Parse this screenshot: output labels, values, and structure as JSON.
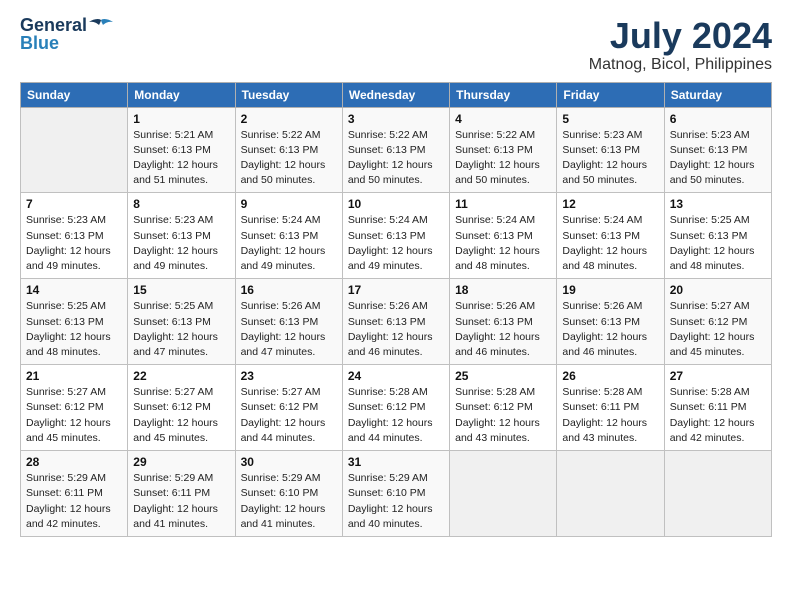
{
  "header": {
    "logo_general": "General",
    "logo_blue": "Blue",
    "month": "July 2024",
    "location": "Matnog, Bicol, Philippines"
  },
  "columns": [
    "Sunday",
    "Monday",
    "Tuesday",
    "Wednesday",
    "Thursday",
    "Friday",
    "Saturday"
  ],
  "weeks": [
    [
      null,
      {
        "day": "1",
        "sunrise": "5:21 AM",
        "sunset": "6:13 PM",
        "daylight": "12 hours and 51 minutes."
      },
      {
        "day": "2",
        "sunrise": "5:22 AM",
        "sunset": "6:13 PM",
        "daylight": "12 hours and 50 minutes."
      },
      {
        "day": "3",
        "sunrise": "5:22 AM",
        "sunset": "6:13 PM",
        "daylight": "12 hours and 50 minutes."
      },
      {
        "day": "4",
        "sunrise": "5:22 AM",
        "sunset": "6:13 PM",
        "daylight": "12 hours and 50 minutes."
      },
      {
        "day": "5",
        "sunrise": "5:23 AM",
        "sunset": "6:13 PM",
        "daylight": "12 hours and 50 minutes."
      },
      {
        "day": "6",
        "sunrise": "5:23 AM",
        "sunset": "6:13 PM",
        "daylight": "12 hours and 50 minutes."
      }
    ],
    [
      {
        "day": "7",
        "sunrise": "5:23 AM",
        "sunset": "6:13 PM",
        "daylight": "12 hours and 49 minutes."
      },
      {
        "day": "8",
        "sunrise": "5:23 AM",
        "sunset": "6:13 PM",
        "daylight": "12 hours and 49 minutes."
      },
      {
        "day": "9",
        "sunrise": "5:24 AM",
        "sunset": "6:13 PM",
        "daylight": "12 hours and 49 minutes."
      },
      {
        "day": "10",
        "sunrise": "5:24 AM",
        "sunset": "6:13 PM",
        "daylight": "12 hours and 49 minutes."
      },
      {
        "day": "11",
        "sunrise": "5:24 AM",
        "sunset": "6:13 PM",
        "daylight": "12 hours and 48 minutes."
      },
      {
        "day": "12",
        "sunrise": "5:24 AM",
        "sunset": "6:13 PM",
        "daylight": "12 hours and 48 minutes."
      },
      {
        "day": "13",
        "sunrise": "5:25 AM",
        "sunset": "6:13 PM",
        "daylight": "12 hours and 48 minutes."
      }
    ],
    [
      {
        "day": "14",
        "sunrise": "5:25 AM",
        "sunset": "6:13 PM",
        "daylight": "12 hours and 48 minutes."
      },
      {
        "day": "15",
        "sunrise": "5:25 AM",
        "sunset": "6:13 PM",
        "daylight": "12 hours and 47 minutes."
      },
      {
        "day": "16",
        "sunrise": "5:26 AM",
        "sunset": "6:13 PM",
        "daylight": "12 hours and 47 minutes."
      },
      {
        "day": "17",
        "sunrise": "5:26 AM",
        "sunset": "6:13 PM",
        "daylight": "12 hours and 46 minutes."
      },
      {
        "day": "18",
        "sunrise": "5:26 AM",
        "sunset": "6:13 PM",
        "daylight": "12 hours and 46 minutes."
      },
      {
        "day": "19",
        "sunrise": "5:26 AM",
        "sunset": "6:13 PM",
        "daylight": "12 hours and 46 minutes."
      },
      {
        "day": "20",
        "sunrise": "5:27 AM",
        "sunset": "6:12 PM",
        "daylight": "12 hours and 45 minutes."
      }
    ],
    [
      {
        "day": "21",
        "sunrise": "5:27 AM",
        "sunset": "6:12 PM",
        "daylight": "12 hours and 45 minutes."
      },
      {
        "day": "22",
        "sunrise": "5:27 AM",
        "sunset": "6:12 PM",
        "daylight": "12 hours and 45 minutes."
      },
      {
        "day": "23",
        "sunrise": "5:27 AM",
        "sunset": "6:12 PM",
        "daylight": "12 hours and 44 minutes."
      },
      {
        "day": "24",
        "sunrise": "5:28 AM",
        "sunset": "6:12 PM",
        "daylight": "12 hours and 44 minutes."
      },
      {
        "day": "25",
        "sunrise": "5:28 AM",
        "sunset": "6:12 PM",
        "daylight": "12 hours and 43 minutes."
      },
      {
        "day": "26",
        "sunrise": "5:28 AM",
        "sunset": "6:11 PM",
        "daylight": "12 hours and 43 minutes."
      },
      {
        "day": "27",
        "sunrise": "5:28 AM",
        "sunset": "6:11 PM",
        "daylight": "12 hours and 42 minutes."
      }
    ],
    [
      {
        "day": "28",
        "sunrise": "5:29 AM",
        "sunset": "6:11 PM",
        "daylight": "12 hours and 42 minutes."
      },
      {
        "day": "29",
        "sunrise": "5:29 AM",
        "sunset": "6:11 PM",
        "daylight": "12 hours and 41 minutes."
      },
      {
        "day": "30",
        "sunrise": "5:29 AM",
        "sunset": "6:10 PM",
        "daylight": "12 hours and 41 minutes."
      },
      {
        "day": "31",
        "sunrise": "5:29 AM",
        "sunset": "6:10 PM",
        "daylight": "12 hours and 40 minutes."
      },
      null,
      null,
      null
    ]
  ]
}
